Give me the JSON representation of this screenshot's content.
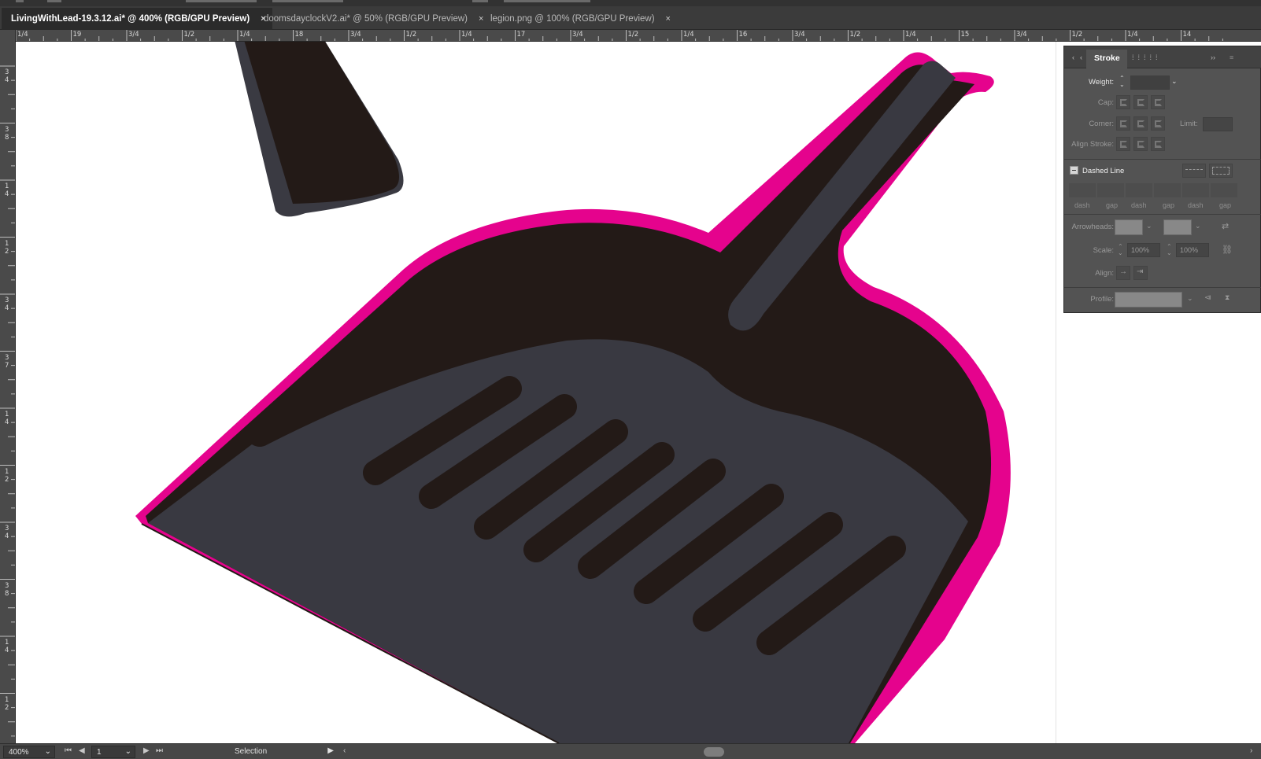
{
  "tabs": [
    {
      "label": "LivingWithLead-19.3.12.ai* @ 400% (RGB/GPU Preview)",
      "active": true,
      "close": "×"
    },
    {
      "label": "doomsdayclockV2.ai* @ 50% (RGB/GPU Preview)",
      "active": false,
      "close": "×"
    },
    {
      "label": "legion.png @ 100% (RGB/GPU Preview)",
      "active": false,
      "close": "×"
    }
  ],
  "ruler": {
    "horizontal": [
      "1/4",
      "19",
      "3/4",
      "1/2",
      "1/4",
      "18",
      "3/4",
      "1/2",
      "1/4",
      "17",
      "3/4",
      "1/2",
      "1/4",
      "16",
      "3/4",
      "1/2",
      "1/4",
      "15",
      "3/4",
      "1/2",
      "1/4",
      "14"
    ],
    "vertical": [
      "3 4",
      "3 8",
      "1 4",
      "1 2",
      "3 4",
      "3 7",
      "1 4",
      "1 2",
      "3 4",
      "3 8",
      "1 4",
      "1 2"
    ]
  },
  "colors": {
    "handle_dark": "#231a17",
    "pan_gray": "#393941",
    "outline_pink": "#e5038d",
    "canvas": "#ffffff"
  },
  "stroke_panel": {
    "tab_label": "Stroke",
    "weight_label": "Weight:",
    "weight_value": "",
    "cap_label": "Cap:",
    "corner_label": "Corner:",
    "limit_label": "Limit:",
    "align_stroke_label": "Align Stroke:",
    "dashed_line_label": "Dashed Line",
    "dash_labels": [
      "dash",
      "gap",
      "dash",
      "gap",
      "dash",
      "gap"
    ],
    "arrowheads_label": "Arrowheads:",
    "scale_label": "Scale:",
    "scale_start": "100%",
    "scale_end": "100%",
    "align_label": "Align:",
    "profile_label": "Profile:"
  },
  "status": {
    "zoom": "400%",
    "page": "1",
    "tool": "Selection"
  }
}
